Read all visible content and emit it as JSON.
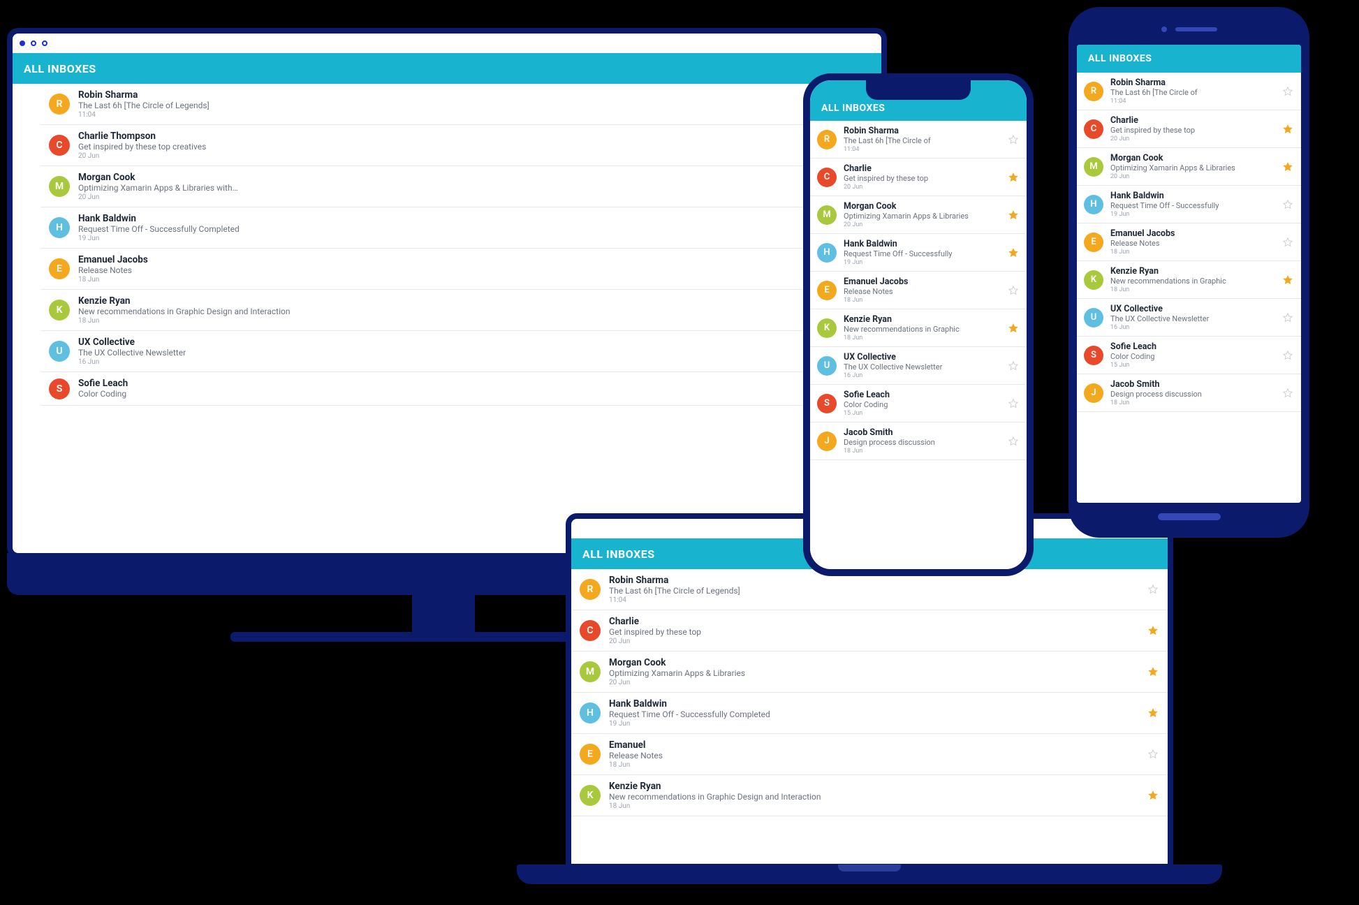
{
  "header_label": "ALL INBOXES",
  "avatar_colors": {
    "R": "#f3a81e",
    "C": "#e8492a",
    "M": "#a9c93c",
    "H": "#5fbfe0",
    "E": "#f3a81e",
    "K": "#a9c93c",
    "U": "#5fbfe0",
    "S": "#e8492a",
    "J": "#f3a81e"
  },
  "desktop": {
    "rows": [
      {
        "initial": "R",
        "sender": "Robin Sharma",
        "subject": "The Last 6h [The Circle of Legends]",
        "time": "11:04",
        "star": null
      },
      {
        "initial": "C",
        "sender": "Charlie Thompson",
        "subject": "Get inspired by these top creatives",
        "time": "20 Jun",
        "star": null
      },
      {
        "initial": "M",
        "sender": "Morgan Cook",
        "subject": "Optimizing Xamarin Apps & Libraries with…",
        "time": "20 Jun",
        "star": null
      },
      {
        "initial": "H",
        "sender": "Hank Baldwin",
        "subject": "Request Time Off - Successfully Completed",
        "time": "19 Jun",
        "star": null
      },
      {
        "initial": "E",
        "sender": "Emanuel Jacobs",
        "subject": "Release Notes",
        "time": "18 Jun",
        "star": null
      },
      {
        "initial": "K",
        "sender": "Kenzie Ryan",
        "subject": "New recommendations in Graphic Design and Interaction",
        "time": "18 Jun",
        "star": null
      },
      {
        "initial": "U",
        "sender": "UX Collective",
        "subject": "The UX Collective Newsletter",
        "time": "16 Jun",
        "star": null
      },
      {
        "initial": "S",
        "sender": "Sofie Leach",
        "subject": "Color Coding",
        "time": "",
        "star": null
      }
    ]
  },
  "laptop": {
    "rows": [
      {
        "initial": "R",
        "sender": "Robin Sharma",
        "subject": "The Last 6h [The Circle of Legends]",
        "time": "11:04",
        "star": false
      },
      {
        "initial": "C",
        "sender": "Charlie",
        "subject": "Get inspired by these top",
        "time": "20 Jun",
        "star": true
      },
      {
        "initial": "M",
        "sender": "Morgan Cook",
        "subject": "Optimizing Xamarin Apps & Libraries",
        "time": "20 Jun",
        "star": true
      },
      {
        "initial": "H",
        "sender": "Hank Baldwin",
        "subject": "Request Time Off - Successfully Completed",
        "time": "19 Jun",
        "star": true
      },
      {
        "initial": "E",
        "sender": "Emanuel",
        "subject": "Release Notes",
        "time": "18 Jun",
        "star": false
      },
      {
        "initial": "K",
        "sender": "Kenzie Ryan",
        "subject": "New recommendations in Graphic Design and Interaction",
        "time": "18 Jun",
        "star": true
      }
    ]
  },
  "phone1": {
    "rows": [
      {
        "initial": "R",
        "sender": "Robin Sharma",
        "subject": "The Last 6h [The Circle of",
        "time": "11:04",
        "star": false
      },
      {
        "initial": "C",
        "sender": "Charlie",
        "subject": "Get inspired by these top",
        "time": "20 Jun",
        "star": true
      },
      {
        "initial": "M",
        "sender": "Morgan Cook",
        "subject": "Optimizing Xamarin Apps & Libraries",
        "time": "20 Jun",
        "star": true
      },
      {
        "initial": "H",
        "sender": "Hank Baldwin",
        "subject": "Request Time Off - Successfully",
        "time": "19 Jun",
        "star": true
      },
      {
        "initial": "E",
        "sender": "Emanuel Jacobs",
        "subject": "Release Notes",
        "time": "18 Jun",
        "star": false
      },
      {
        "initial": "K",
        "sender": "Kenzie Ryan",
        "subject": "New recommendations in Graphic",
        "time": "18 Jun",
        "star": true
      },
      {
        "initial": "U",
        "sender": "UX Collective",
        "subject": "The UX Collective Newsletter",
        "time": "16 Jun",
        "star": false
      },
      {
        "initial": "S",
        "sender": "Sofie Leach",
        "subject": "Color Coding",
        "time": "15 Jun",
        "star": false
      },
      {
        "initial": "J",
        "sender": "Jacob Smith",
        "subject": "Design process discussion",
        "time": "18 Jun",
        "star": false
      }
    ]
  },
  "phone2": {
    "rows": [
      {
        "initial": "R",
        "sender": "Robin Sharma",
        "subject": "The Last 6h [The Circle of",
        "time": "11:04",
        "star": false
      },
      {
        "initial": "C",
        "sender": "Charlie",
        "subject": "Get inspired by these top",
        "time": "20 Jun",
        "star": true
      },
      {
        "initial": "M",
        "sender": "Morgan Cook",
        "subject": "Optimizing Xamarin Apps & Libraries",
        "time": "20 Jun",
        "star": true
      },
      {
        "initial": "H",
        "sender": "Hank Baldwin",
        "subject": "Request Time Off - Successfully",
        "time": "19 Jun",
        "star": false
      },
      {
        "initial": "E",
        "sender": "Emanuel Jacobs",
        "subject": "Release Notes",
        "time": "18 Jun",
        "star": false
      },
      {
        "initial": "K",
        "sender": "Kenzie Ryan",
        "subject": "New recommendations in Graphic",
        "time": "18 Jun",
        "star": true
      },
      {
        "initial": "U",
        "sender": "UX Collective",
        "subject": "The UX Collective Newsletter",
        "time": "16 Jun",
        "star": false
      },
      {
        "initial": "S",
        "sender": "Sofie Leach",
        "subject": "Color Coding",
        "time": "15 Jun",
        "star": false
      },
      {
        "initial": "J",
        "sender": "Jacob Smith",
        "subject": "Design process discussion",
        "time": "18 Jun",
        "star": false
      }
    ]
  }
}
